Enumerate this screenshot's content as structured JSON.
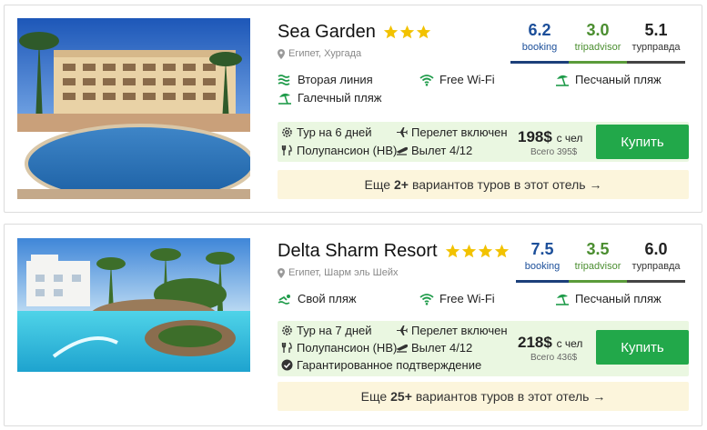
{
  "hotels": [
    {
      "name": "Sea Garden",
      "stars": 3,
      "location": "Египет, Хургада",
      "ratings": [
        {
          "score": "6.2",
          "source": "booking"
        },
        {
          "score": "3.0",
          "source": "tripadvisor"
        },
        {
          "score": "5.1",
          "source": "турправда"
        }
      ],
      "features": [
        "Вторая линия",
        "Free Wi-Fi",
        "Песчаный пляж",
        "Галечный пляж"
      ],
      "tour_days": "Тур на 6 дней",
      "flight": "Перелет включен",
      "meal": "Полупансион (HB)",
      "departure": "Вылет 4/12",
      "price": "198$",
      "price_unit": "с чел",
      "total": "Всего 395$",
      "buy_label": "Купить",
      "more_prefix": "Еще",
      "more_count": "2+",
      "more_suffix": "вариантов туров в этот отель →"
    },
    {
      "name": "Delta Sharm Resort",
      "stars": 4,
      "location": "Египет, Шарм эль Шейх",
      "ratings": [
        {
          "score": "7.5",
          "source": "booking"
        },
        {
          "score": "3.5",
          "source": "tripadvisor"
        },
        {
          "score": "6.0",
          "source": "турправда"
        }
      ],
      "features": [
        "Свой пляж",
        "Free Wi-Fi",
        "Песчаный пляж"
      ],
      "tour_days": "Тур на 7 дней",
      "flight": "Перелет включен",
      "meal": "Полупансион (HB)",
      "departure": "Вылет 4/12",
      "guarantee": "Гарантированное подтверждение",
      "price": "218$",
      "price_unit": "с чел",
      "total": "Всего 436$",
      "buy_label": "Купить",
      "more_prefix": "Еще",
      "more_count": "25+",
      "more_suffix": "вариантов туров в этот отель →"
    }
  ],
  "colors": {
    "booking": "#1c4f9a",
    "tripadvisor": "#4b8e30",
    "buy_button": "#22a84a",
    "offer_bg": "#eaf7e1",
    "more_bg": "#fcf5dc",
    "star": "#f2c200",
    "feature_icon": "#1f9b4a"
  }
}
